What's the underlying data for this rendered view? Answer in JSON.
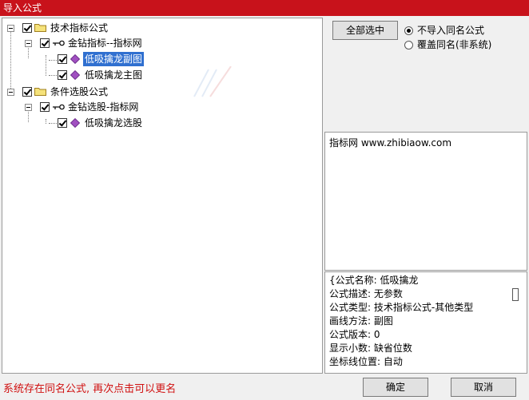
{
  "window": {
    "title": "导入公式"
  },
  "tree": {
    "nodes": [
      {
        "label": "技术指标公式"
      },
      {
        "label": "金钻指标--指标网"
      },
      {
        "label": "低吸擒龙副图"
      },
      {
        "label": "低吸擒龙主图"
      },
      {
        "label": "条件选股公式"
      },
      {
        "label": "金钻选股-指标网"
      },
      {
        "label": "低吸擒龙选股"
      }
    ]
  },
  "actions": {
    "select_all_label": "全部选中",
    "options": [
      {
        "label": "不导入同名公式",
        "selected": true
      },
      {
        "label": "覆盖同名(非系统)",
        "selected": false
      }
    ]
  },
  "source_text": "指标网 www.zhibiaow.com",
  "formula_info": {
    "lines": [
      "{公式名称: 低吸擒龙",
      "公式描述: 无参数",
      "公式类型: 技术指标公式-其他类型",
      "画线方法: 副图",
      "公式版本: 0",
      "显示小数: 缺省位数",
      "坐标线位置: 自动"
    ]
  },
  "status_message": "系统存在同名公式, 再次点击可以更名",
  "footer": {
    "ok_label": "确定",
    "cancel_label": "取消"
  },
  "colors": {
    "title_bar": "#c8121b",
    "selection": "#3070d0",
    "status_text": "#d01010"
  }
}
